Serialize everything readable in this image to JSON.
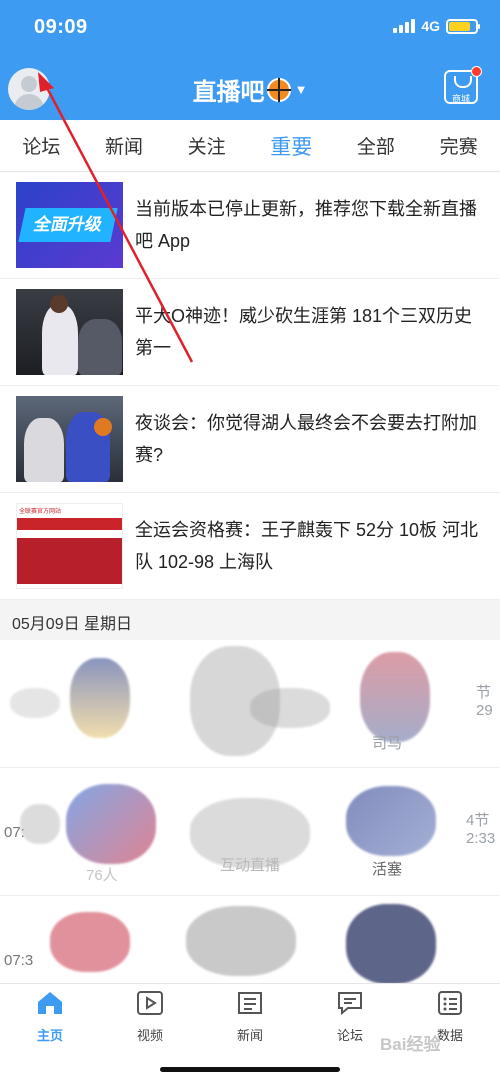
{
  "status_bar": {
    "time": "09:09",
    "network": "4G",
    "battery_level": 0.8,
    "battery_color": "#ffd21f"
  },
  "header": {
    "avatar_icon": "user-avatar-icon",
    "brand": "直播吧",
    "brand_icon": "basketball-icon",
    "dropdown_icon": "caret-down-icon",
    "shop_label": "商城",
    "shop_icon": "shopping-bag-icon",
    "background_color": "#3d9bf2"
  },
  "tabs": [
    {
      "label": "论坛",
      "active": false
    },
    {
      "label": "新闻",
      "active": false
    },
    {
      "label": "关注",
      "active": false
    },
    {
      "label": "重要",
      "active": true
    },
    {
      "label": "全部",
      "active": false
    },
    {
      "label": "完赛",
      "active": false
    }
  ],
  "news": [
    {
      "title": "当前版本已停止更新，推荐您下载全新直播吧 App",
      "thumb_text": "全面升级"
    },
    {
      "title": "平大O神迹！威少砍生涯第 181个三双历史第一"
    },
    {
      "title": "夜谈会：你觉得湖人最终会不会要去打附加赛?"
    },
    {
      "title": "全运会资格赛：王子麒轰下 52分 10板 河北队 102-98 上海队",
      "thumb_text": "全联赛官方网站"
    }
  ],
  "date_header": "05月09日 星期日",
  "games": {
    "row1": {
      "right_time": "节\n29",
      "team": "司马"
    },
    "row2": {
      "left_time": "07:",
      "right_time": "4节\n2:33",
      "center_label": "互动直播",
      "left_team": "76人",
      "right_team": "活塞"
    },
    "row3": {
      "left_time": "07:3"
    }
  },
  "bottom_nav": [
    {
      "label": "主页",
      "icon": "home-icon",
      "active": true
    },
    {
      "label": "视频",
      "icon": "video-play-icon",
      "active": false
    },
    {
      "label": "新闻",
      "icon": "newspaper-icon",
      "active": false
    },
    {
      "label": "论坛",
      "icon": "chat-bubble-icon",
      "active": false
    },
    {
      "label": "数据",
      "icon": "data-list-icon",
      "active": false
    }
  ],
  "watermark": "Bai经验",
  "colors": {
    "accent": "#3d9bf2",
    "annotation_arrow": "#e0202a"
  }
}
